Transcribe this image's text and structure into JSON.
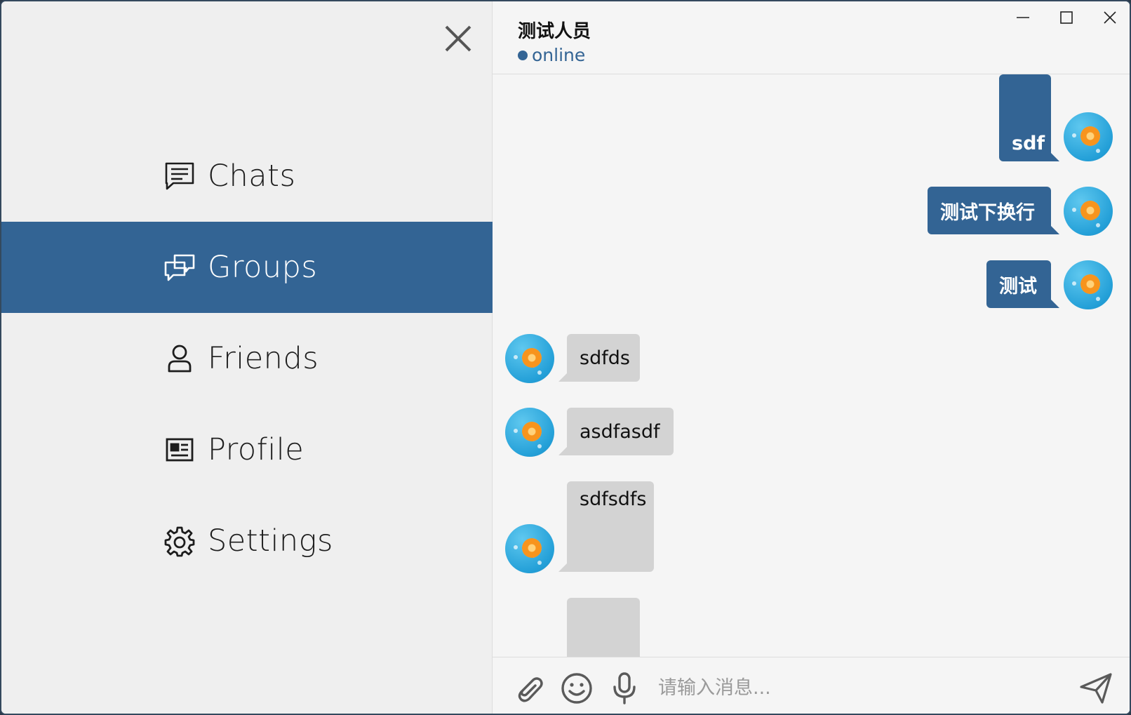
{
  "sidebar": {
    "items": [
      {
        "label": "Chats",
        "icon": "chat-lines-icon",
        "active": false
      },
      {
        "label": "Groups",
        "icon": "groups-icon",
        "active": true
      },
      {
        "label": "Friends",
        "icon": "person-icon",
        "active": false
      },
      {
        "label": "Profile",
        "icon": "id-card-icon",
        "active": false
      },
      {
        "label": "Settings",
        "icon": "gear-icon",
        "active": false
      }
    ]
  },
  "chat": {
    "title": "测试人员",
    "status": "online",
    "messages": [
      {
        "direction": "out",
        "text": "sdf"
      },
      {
        "direction": "out",
        "text": "测试下换行"
      },
      {
        "direction": "out",
        "text": "测试"
      },
      {
        "direction": "in",
        "text": "sdfds"
      },
      {
        "direction": "in",
        "text": "asdfasdf"
      },
      {
        "direction": "in",
        "text": "sdfsdfs"
      },
      {
        "direction": "in",
        "text": ""
      }
    ]
  },
  "input": {
    "placeholder": "请输入消息..."
  },
  "colors": {
    "accent": "#336494",
    "incoming_bubble": "#d3d3d3",
    "sidebar_bg": "#efefef",
    "chat_bg": "#f5f5f5"
  }
}
